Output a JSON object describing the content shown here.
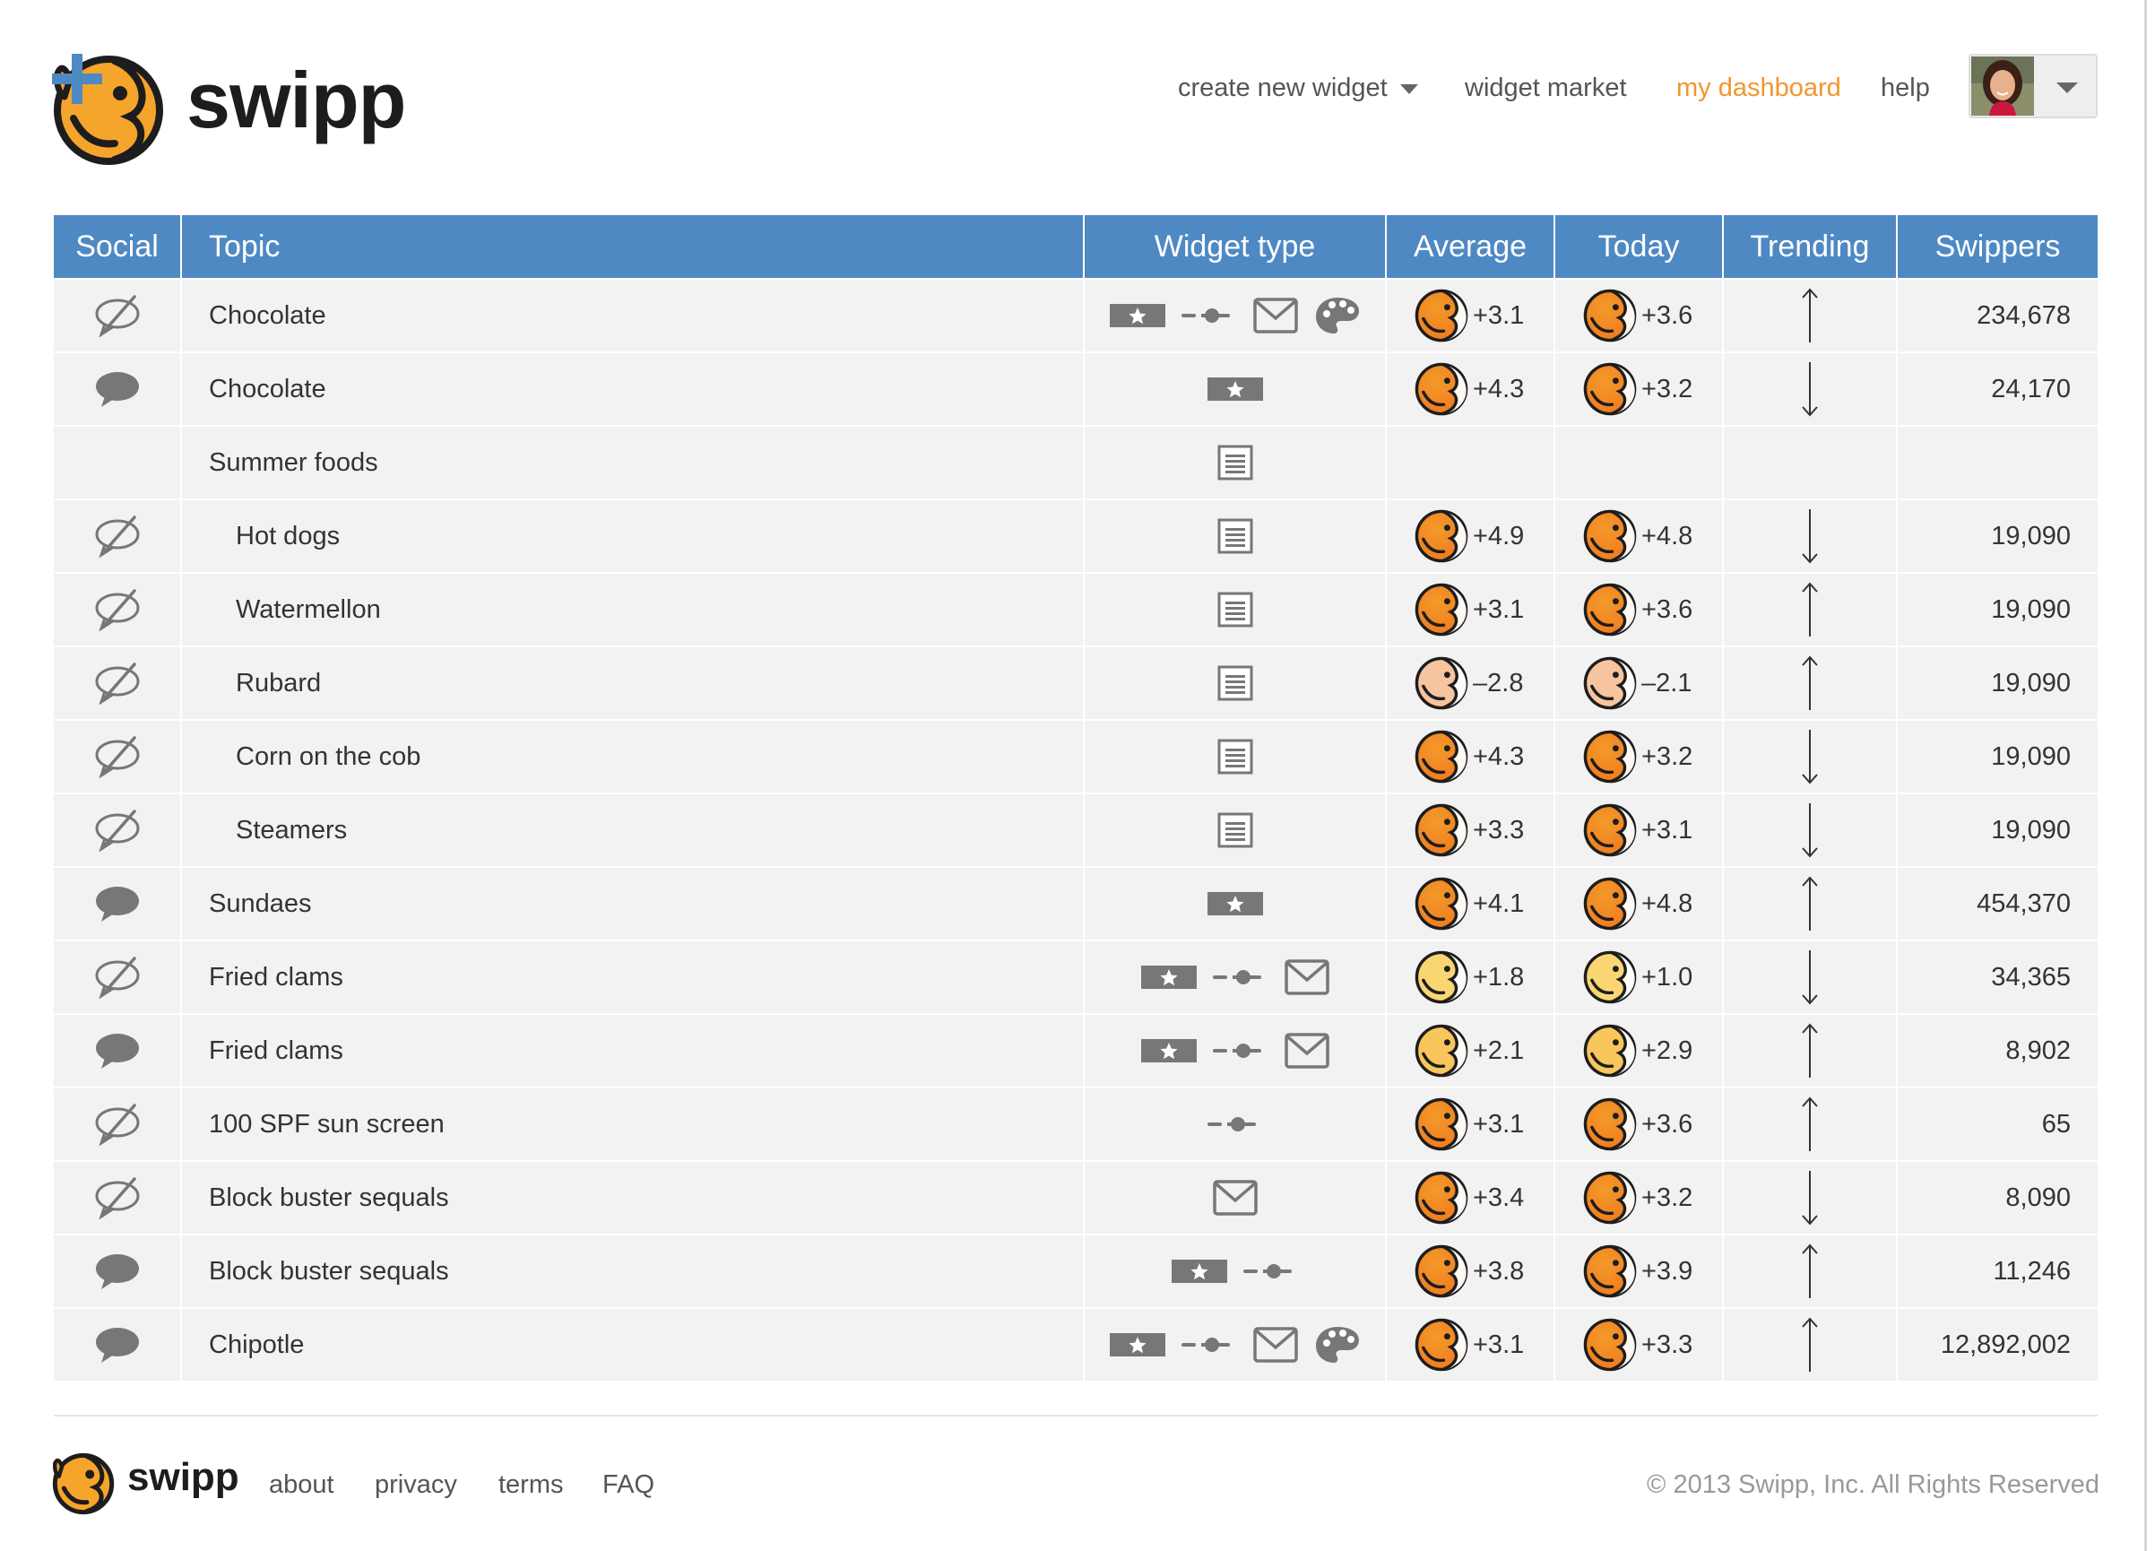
{
  "brand": {
    "name": "swipp",
    "footer_name": "swipp"
  },
  "colors": {
    "accent": "#f1962d",
    "header_blue": "#4f89c3",
    "plus_blue": "#4f89c3",
    "row_bg": "#f2f2f2",
    "icon_gray": "#777777"
  },
  "nav": {
    "create_widget": "create new widget",
    "widget_market": "widget market",
    "my_dashboard": "my dashboard",
    "help": "help",
    "active_item": "my dashboard"
  },
  "table": {
    "columns": [
      "Social",
      "Topic",
      "Widget type",
      "Average",
      "Today",
      "Trending",
      "Swippers"
    ],
    "rows": [
      {
        "social": "no-comment-icon",
        "topic": "Chocolate",
        "indent": false,
        "widgets": [
          "star-rating",
          "slider",
          "mail",
          "palette"
        ],
        "average": "+3.1",
        "average_tone": "high",
        "today": "+3.6",
        "today_tone": "high",
        "trend": "up",
        "swippers": "234,678"
      },
      {
        "social": "comment-icon",
        "topic": "Chocolate",
        "indent": false,
        "widgets": [
          "star-rating"
        ],
        "average": "+4.3",
        "average_tone": "high",
        "today": "+3.2",
        "today_tone": "high",
        "trend": "down",
        "swippers": "24,170"
      },
      {
        "social": "none",
        "topic": "Summer foods",
        "indent": false,
        "widgets": [
          "list"
        ],
        "average": "",
        "average_tone": "none",
        "today": "",
        "today_tone": "none",
        "trend": "none",
        "swippers": ""
      },
      {
        "social": "no-comment-icon",
        "topic": "Hot dogs",
        "indent": true,
        "widgets": [
          "list"
        ],
        "average": "+4.9",
        "average_tone": "high",
        "today": "+4.8",
        "today_tone": "high",
        "trend": "down",
        "swippers": "19,090"
      },
      {
        "social": "no-comment-icon",
        "topic": "Watermellon",
        "indent": true,
        "widgets": [
          "list"
        ],
        "average": "+3.1",
        "average_tone": "high",
        "today": "+3.6",
        "today_tone": "high",
        "trend": "up",
        "swippers": "19,090"
      },
      {
        "social": "no-comment-icon",
        "topic": "Rubard",
        "indent": true,
        "widgets": [
          "list"
        ],
        "average": "–2.8",
        "average_tone": "negative",
        "today": "–2.1",
        "today_tone": "negative",
        "trend": "up",
        "swippers": "19,090"
      },
      {
        "social": "no-comment-icon",
        "topic": "Corn on the cob",
        "indent": true,
        "widgets": [
          "list"
        ],
        "average": "+4.3",
        "average_tone": "high",
        "today": "+3.2",
        "today_tone": "high",
        "trend": "down",
        "swippers": "19,090"
      },
      {
        "social": "no-comment-icon",
        "topic": "Steamers",
        "indent": true,
        "widgets": [
          "list"
        ],
        "average": "+3.3",
        "average_tone": "high",
        "today": "+3.1",
        "today_tone": "high",
        "trend": "down",
        "swippers": "19,090"
      },
      {
        "social": "comment-icon",
        "topic": "Sundaes",
        "indent": false,
        "widgets": [
          "star-rating"
        ],
        "average": "+4.1",
        "average_tone": "high",
        "today": "+4.8",
        "today_tone": "high",
        "trend": "up",
        "swippers": "454,370"
      },
      {
        "social": "no-comment-icon",
        "topic": "Fried clams",
        "indent": false,
        "widgets": [
          "star-rating",
          "slider",
          "mail"
        ],
        "average": "+1.8",
        "average_tone": "low",
        "today": "+1.0",
        "today_tone": "low",
        "trend": "down",
        "swippers": "34,365"
      },
      {
        "social": "comment-icon",
        "topic": "Fried clams",
        "indent": false,
        "widgets": [
          "star-rating",
          "slider",
          "mail"
        ],
        "average": "+2.1",
        "average_tone": "mid",
        "today": "+2.9",
        "today_tone": "mid",
        "trend": "up",
        "swippers": "8,902"
      },
      {
        "social": "no-comment-icon",
        "topic": "100 SPF sun screen",
        "indent": false,
        "widgets": [
          "slider"
        ],
        "average": "+3.1",
        "average_tone": "high",
        "today": "+3.6",
        "today_tone": "high",
        "trend": "up",
        "swippers": "65"
      },
      {
        "social": "no-comment-icon",
        "topic": "Block buster sequals",
        "indent": false,
        "widgets": [
          "mail"
        ],
        "average": "+3.4",
        "average_tone": "high",
        "today": "+3.2",
        "today_tone": "high",
        "trend": "down",
        "swippers": "8,090"
      },
      {
        "social": "comment-icon",
        "topic": "Block buster sequals",
        "indent": false,
        "widgets": [
          "star-rating",
          "slider"
        ],
        "average": "+3.8",
        "average_tone": "high",
        "today": "+3.9",
        "today_tone": "high",
        "trend": "up",
        "swippers": "11,246"
      },
      {
        "social": "comment-icon",
        "topic": "Chipotle",
        "indent": false,
        "widgets": [
          "star-rating",
          "slider",
          "mail",
          "palette"
        ],
        "average": "+3.1",
        "average_tone": "high",
        "today": "+3.3",
        "today_tone": "high",
        "trend": "up",
        "swippers": "12,892,002"
      }
    ]
  },
  "footer": {
    "links": [
      "about",
      "privacy",
      "terms",
      "FAQ"
    ],
    "copyright": "© 2013 Swipp, Inc. All Rights Reserved"
  }
}
